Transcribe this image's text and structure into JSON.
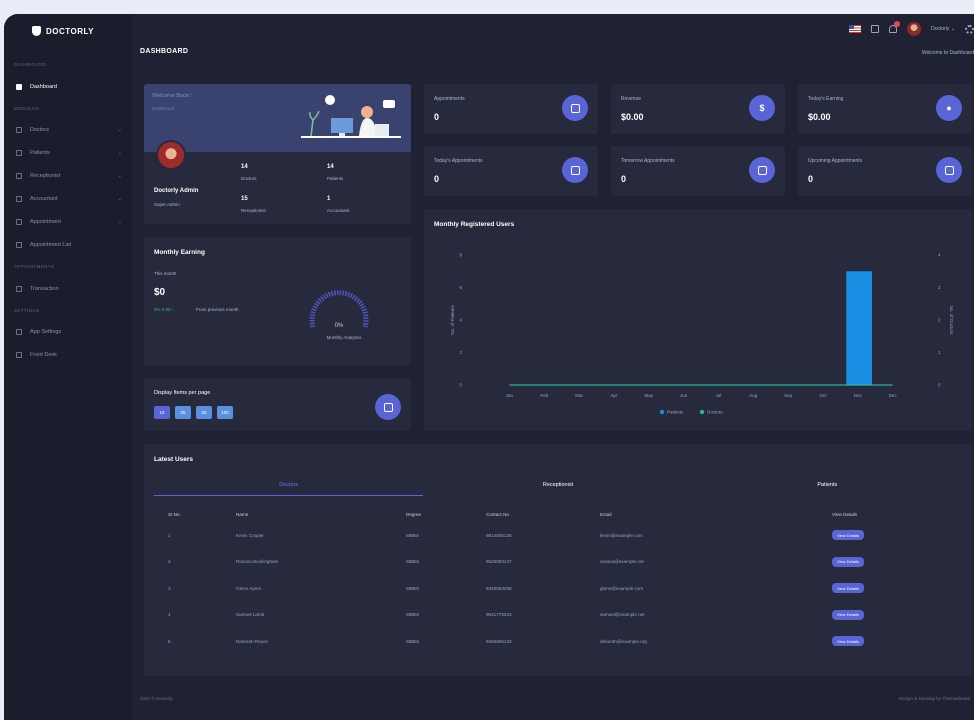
{
  "app": {
    "brand": "DOCTORLY"
  },
  "sidebar": {
    "sections": [
      "Dashboard",
      "Modules",
      "Appointments",
      "Settings"
    ],
    "items": [
      {
        "label": "Dashboard",
        "icon": "home-icon",
        "active": true,
        "chevron": false
      },
      {
        "label": "Doctors",
        "icon": "doctor-icon",
        "active": false,
        "chevron": true
      },
      {
        "label": "Patients",
        "icon": "patient-icon",
        "active": false,
        "chevron": true
      },
      {
        "label": "Receptionist",
        "icon": "receptionist-icon",
        "active": false,
        "chevron": true
      },
      {
        "label": "Accountant",
        "icon": "accountant-icon",
        "active": false,
        "chevron": true
      },
      {
        "label": "Appointment",
        "icon": "calendar-icon",
        "active": false,
        "chevron": true
      },
      {
        "label": "Appointment List",
        "icon": "list-icon",
        "active": false,
        "chevron": false
      },
      {
        "label": "Transaction",
        "icon": "transaction-icon",
        "active": false,
        "chevron": false
      },
      {
        "label": "App Settings",
        "icon": "settings-icon",
        "active": false,
        "chevron": false
      },
      {
        "label": "Front Desk",
        "icon": "desk-icon",
        "active": false,
        "chevron": false
      }
    ]
  },
  "topbar": {
    "user_name": "Doctorly ⌄"
  },
  "page": {
    "title": "DASHBOARD",
    "crumb": "Welcome to Dashboard"
  },
  "profile": {
    "banner_title": "Welcome Back !",
    "banner_sub": "Dashboard",
    "name": "Doctorly Admin",
    "role": "Super Admin",
    "stats": [
      {
        "value": "14",
        "label": "Doctors"
      },
      {
        "value": "14",
        "label": "Patients"
      },
      {
        "value": "15",
        "label": "Receptionist"
      },
      {
        "value": "1",
        "label": "Accountant"
      }
    ]
  },
  "metrics": [
    {
      "label": "Appointments",
      "value": "0",
      "icon": "calendar-icon"
    },
    {
      "label": "Revenue",
      "value": "$0.00",
      "icon": "dollar-icon"
    },
    {
      "label": "Today's Earning",
      "value": "$0.00",
      "icon": "coin-icon"
    },
    {
      "label": "Today's Appointments",
      "value": "0",
      "icon": "calendar-check-icon"
    },
    {
      "label": "Tomorrow Appointments",
      "value": "0",
      "icon": "calendar-plus-icon"
    },
    {
      "label": "Upcoming Appointments",
      "value": "0",
      "icon": "calendar-clock-icon"
    }
  ],
  "earning": {
    "title": "Monthly Earning",
    "sub": "This month",
    "value": "$0",
    "change": "0% 0.00 ↑",
    "prev": "From previous month",
    "gauge_value": "0%",
    "gauge_label": "Monthly Analytics",
    "gauge_fraction": 0
  },
  "per_page": {
    "title": "Display Items per page",
    "options": [
      "10",
      "25",
      "50",
      "100"
    ]
  },
  "chart_data": {
    "type": "bar",
    "title": "Monthly Registered Users",
    "categories": [
      "Jan",
      "Feb",
      "Mar",
      "Apr",
      "May",
      "Jun",
      "Jul",
      "Aug",
      "Sep",
      "Oct",
      "Nov",
      "Dec"
    ],
    "series": [
      {
        "name": "Patients",
        "values": [
          0,
          0,
          0,
          0,
          0,
          0,
          0,
          0,
          0,
          0,
          7,
          0
        ],
        "color": "#1a8fe3",
        "kind": "bar"
      },
      {
        "name": "Doctors",
        "values": [
          0,
          0,
          0,
          0,
          0,
          0,
          0,
          0,
          0,
          0,
          0,
          0
        ],
        "color": "#26b79a",
        "kind": "line"
      }
    ],
    "ylabel": "No. of Patients",
    "y2label": "No. of Doctors",
    "ylim": [
      0,
      8
    ],
    "yticks": [
      "0",
      "2",
      "4",
      "6",
      "8"
    ],
    "y2ticks": [
      "0",
      "1",
      "2",
      "3",
      "4"
    ],
    "legend": "bottom",
    "grid": false
  },
  "latest_users": {
    "title": "Latest Users",
    "tabs": [
      "Doctors",
      "Receptionist",
      "Patients"
    ],
    "columns": [
      "Sr.No.",
      "Name",
      "Degree",
      "Contact No",
      "Email",
      "View Details"
    ],
    "rows": [
      {
        "sr": "1",
        "name": "Kevin Cooper",
        "degree": "MBBS",
        "contact": "9514805125",
        "email": "kevin@example.com"
      },
      {
        "sr": "2",
        "name": "Roxana Buckingham",
        "degree": "MBBS",
        "contact": "9525893147",
        "email": "roxana@example.net"
      },
      {
        "sr": "3",
        "name": "Glenn Ayers",
        "degree": "MBBS",
        "contact": "9340563258",
        "email": "glenn@example.com"
      },
      {
        "sr": "4",
        "name": "Samuel Lamb",
        "degree": "MBBS",
        "contact": "9541775203",
        "email": "samuel@example.net"
      },
      {
        "sr": "5",
        "name": "Deborah Reyes",
        "degree": "MBBS",
        "contact": "9266855133",
        "email": "deborah@example.org"
      }
    ],
    "view_label": "View Details"
  },
  "footer": {
    "left": "2022 © Doctorly.",
    "right": "Design & Develop by Themesbrand"
  },
  "colors": {
    "accent": "#5964d6",
    "bg": "#1f2233",
    "card": "#272a3d",
    "bar": "#1a8fe3",
    "line": "#26b79a"
  }
}
